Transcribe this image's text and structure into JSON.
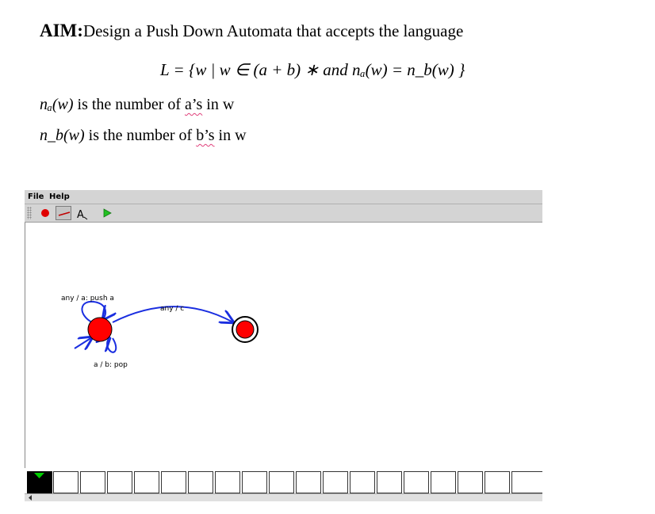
{
  "document": {
    "aim_label": "AIM:",
    "aim_text": "Design a Push Down Automata that accepts the language",
    "formula": "L = {w | w ∈ (a + b) ∗ and nₐ(w) = n_b(w) }",
    "line1": {
      "math": "nₐ(w)",
      "before": " is the number of ",
      "underlined": "a’s",
      "after": " in w"
    },
    "line2": {
      "math": "n_b(w)",
      "before": " is the number of ",
      "underlined": "b’s",
      "after": " in w"
    }
  },
  "app": {
    "menu": {
      "file": "File",
      "help": "Help"
    },
    "toolbar": {
      "tools": [
        {
          "name": "state-tool",
          "icon": "red-circle-icon"
        },
        {
          "name": "transition-tool",
          "icon": "arrow-line-icon",
          "pressed": true
        },
        {
          "name": "label-tool",
          "icon": "text-a-icon"
        },
        {
          "name": "run-tool",
          "icon": "play-icon"
        }
      ]
    },
    "automaton": {
      "states": [
        {
          "id": "q0",
          "initial": true,
          "accepting": false,
          "color": "#ff0000"
        },
        {
          "id": "q1",
          "initial": false,
          "accepting": true,
          "color": "#ff0000"
        }
      ],
      "transitions": [
        {
          "from": "q0",
          "to": "q0",
          "label": "any / a: push a"
        },
        {
          "from": "q0",
          "to": "q0",
          "label": "a / b: pop"
        },
        {
          "from": "q0",
          "to": "q1",
          "label": "any / c"
        }
      ],
      "edge_color": "#1a2ee0"
    },
    "tape": {
      "cell_count": 19,
      "head_color": "#00cc00"
    }
  }
}
